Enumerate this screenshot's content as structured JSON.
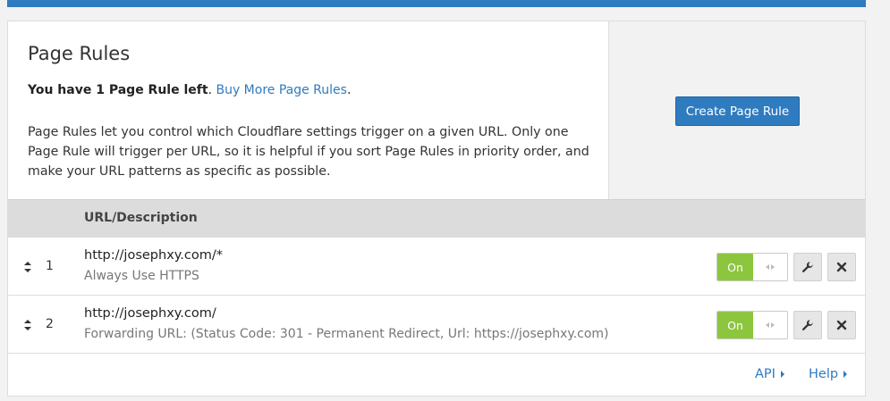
{
  "page": {
    "title": "Page Rules",
    "quota_bold": "You have 1 Page Rule left",
    "quota_period": ".",
    "buy_more_link": "Buy More Page Rules",
    "buy_more_period": ".",
    "description": "Page Rules let you control which Cloudflare settings trigger on a given URL. Only one Page Rule will trigger per URL, so it is helpful if you sort Page Rules in priority order, and make your URL patterns as specific as possible.",
    "create_button": "Create Page Rule"
  },
  "table": {
    "column_header": "URL/Description",
    "rows": [
      {
        "number": "1",
        "url": "http://josephxy.com/*",
        "setting": "Always Use HTTPS",
        "toggle_label": "On"
      },
      {
        "number": "2",
        "url": "http://josephxy.com/",
        "setting": "Forwarding URL: (Status Code: 301 - Permanent Redirect, Url: https://josephxy.com)",
        "toggle_label": "On"
      }
    ]
  },
  "footer": {
    "api_link": "API",
    "help_link": "Help"
  },
  "colors": {
    "accent": "#2f7bbf",
    "toggle_on": "#8cc63f"
  },
  "icons": [
    "sort-handle-icon",
    "toggle-arrows-icon",
    "wrench-icon",
    "close-icon",
    "caret-right-icon"
  ]
}
